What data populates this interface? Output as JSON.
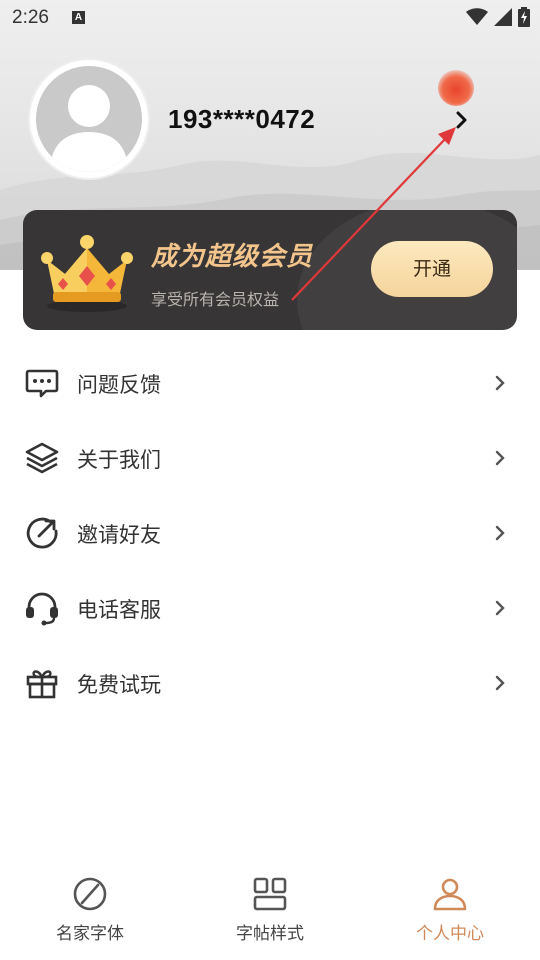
{
  "status_bar": {
    "time": "2:26",
    "a_badge": "A",
    "icons": [
      "wifi-icon",
      "signal-icon",
      "battery-charging-icon"
    ]
  },
  "profile": {
    "phone": "193****0472",
    "avatar_icon": "default-avatar-icon",
    "chevron_icon": "chevron-right-icon"
  },
  "vip": {
    "title": "成为超级会员",
    "subtitle": "享受所有会员权益",
    "button": "开通",
    "icon": "crown-icon",
    "accent": "#f3c58c"
  },
  "menu": {
    "items": [
      {
        "label": "问题反馈",
        "icon": "feedback-chat-icon"
      },
      {
        "label": "关于我们",
        "icon": "layers-icon"
      },
      {
        "label": "邀请好友",
        "icon": "share-circle-icon"
      },
      {
        "label": "电话客服",
        "icon": "headset-icon"
      },
      {
        "label": "免费试玩",
        "icon": "gift-icon"
      }
    ]
  },
  "tabbar": {
    "tabs": [
      {
        "label": "名家字体",
        "icon": "pen-nib-icon",
        "active": false
      },
      {
        "label": "字帖样式",
        "icon": "grid-icon",
        "active": false
      },
      {
        "label": "个人中心",
        "icon": "person-icon",
        "active": true
      }
    ],
    "active_color": "#d08a5a"
  }
}
